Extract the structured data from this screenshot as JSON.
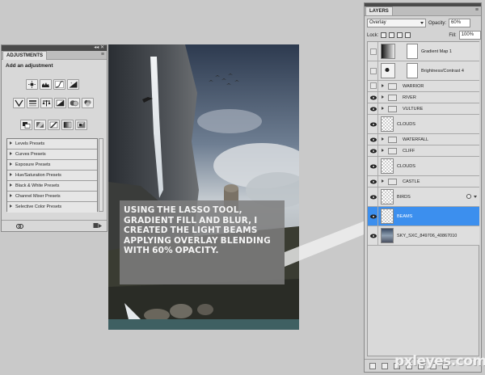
{
  "adjustments_panel": {
    "tab_label": "ADJUSTMENTS",
    "heading": "Add an adjustment",
    "icons_row1": [
      "brightness-icon",
      "levels-icon",
      "curves-icon",
      "exposure-icon"
    ],
    "icons_row2": [
      "vibrance-icon",
      "hue-saturation-icon",
      "color-balance-icon",
      "black-white-icon",
      "photo-filter-icon",
      "channel-mixer-icon"
    ],
    "icons_row3": [
      "invert-icon",
      "posterize-icon",
      "threshold-icon",
      "gradient-map-icon",
      "selective-color-icon"
    ],
    "presets": [
      "Levels Presets",
      "Curves Presets",
      "Exposure Presets",
      "Hue/Saturation Presets",
      "Black & White Presets",
      "Channel Mixer Presets",
      "Selective Color Presets"
    ]
  },
  "callout": {
    "text": "USING THE LASSO TOOL, GRADIENT FILL AND BLUR, I CREATED THE LIGHT BEAMS APPLYING OVERLAY BLENDING WITH 60% OPACITY."
  },
  "layers_panel": {
    "tab_label": "LAYERS",
    "blend_mode": "Overlay",
    "opacity_label": "Opacity:",
    "opacity_value": "60%",
    "lock_label": "Lock:",
    "fill_label": "Fill:",
    "fill_value": "100%",
    "layers": [
      {
        "name": "Gradient Map 1",
        "kind": "adjustment",
        "visible": false
      },
      {
        "name": "Brightness/Contrast 4",
        "kind": "adjustment",
        "visible": false
      },
      {
        "name": "WARRIOR",
        "kind": "group",
        "visible": false
      },
      {
        "name": "RIVER",
        "kind": "group",
        "visible": true
      },
      {
        "name": "VULTURE",
        "kind": "group",
        "visible": true
      },
      {
        "name": "CLOUDS",
        "kind": "layer",
        "visible": true
      },
      {
        "name": "WATERFALL",
        "kind": "group",
        "visible": true
      },
      {
        "name": "CLIFF",
        "kind": "group",
        "visible": true
      },
      {
        "name": "CLOUDS",
        "kind": "layer",
        "visible": true
      },
      {
        "name": "CASTLE",
        "kind": "group",
        "visible": true
      },
      {
        "name": "BIRDS",
        "kind": "layer",
        "visible": true
      },
      {
        "name": "BEAMS",
        "kind": "layer",
        "visible": true,
        "selected": true
      },
      {
        "name": "SKY_SXC_849706_40867010",
        "kind": "layer",
        "visible": true
      }
    ]
  },
  "watermark": {
    "text": "pxleyes.com"
  },
  "colors": {
    "workspace": "#c9c9c9",
    "selection": "#3c8fee",
    "panel": "#d3d3d3"
  }
}
